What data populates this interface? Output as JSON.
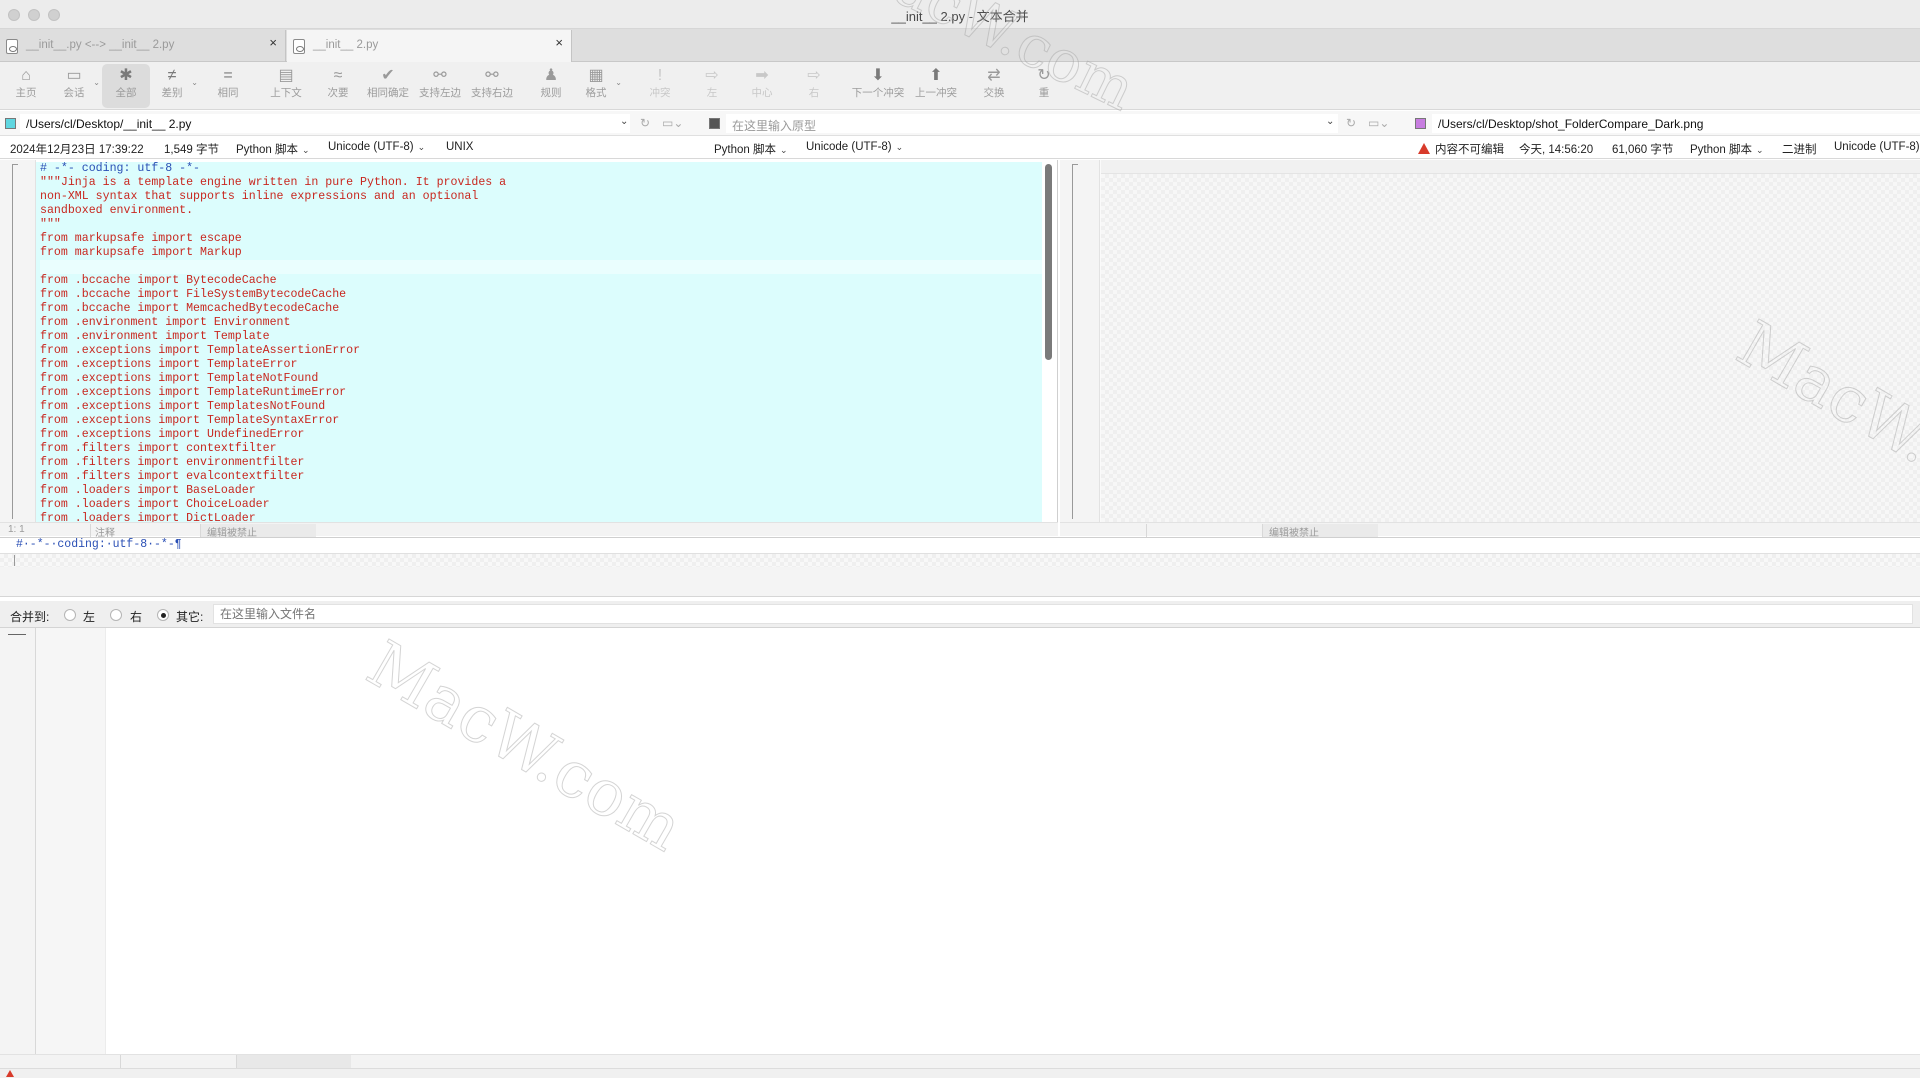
{
  "window": {
    "title": "__init__ 2.py - 文本合并"
  },
  "tabs": [
    {
      "label": "__init__.py <--> __init__ 2.py",
      "active": false
    },
    {
      "label": "__init__ 2.py",
      "active": true
    }
  ],
  "toolbar": {
    "items": [
      {
        "label": "主页",
        "icon": "home-icon",
        "glyph": "⌂"
      },
      {
        "label": "会话",
        "icon": "session-icon",
        "glyph": "▭"
      },
      {
        "label": "全部",
        "icon": "asterisk-icon",
        "glyph": "✱"
      },
      {
        "label": "差别",
        "icon": "not-equal-icon",
        "glyph": "≠"
      },
      {
        "label": "相同",
        "icon": "equal-icon",
        "glyph": "="
      },
      {
        "label": "上下文",
        "icon": "context-icon",
        "glyph": "▤"
      },
      {
        "label": "次要",
        "icon": "approx-icon",
        "glyph": "≈"
      },
      {
        "label": "相同确定",
        "icon": "check-icon",
        "glyph": "✔"
      },
      {
        "label": "支持左边",
        "icon": "link-left-icon",
        "glyph": "⚯"
      },
      {
        "label": "支持右边",
        "icon": "link-right-icon",
        "glyph": "⚯"
      },
      {
        "label": "规则",
        "icon": "rules-icon",
        "glyph": "♟"
      },
      {
        "label": "格式",
        "icon": "format-icon",
        "glyph": "▦"
      },
      {
        "label": "冲突",
        "icon": "conflict-icon",
        "glyph": "!"
      },
      {
        "label": "左",
        "icon": "arrow-left-icon",
        "glyph": "⇨"
      },
      {
        "label": "中心",
        "icon": "arrow-center-icon",
        "glyph": "➡"
      },
      {
        "label": "右",
        "icon": "arrow-right-icon",
        "glyph": "⇨"
      },
      {
        "label": "下一个冲突",
        "icon": "next-conflict-icon",
        "glyph": "⬇"
      },
      {
        "label": "上一冲突",
        "icon": "prev-conflict-icon",
        "glyph": "⬆"
      },
      {
        "label": "交换",
        "icon": "swap-icon",
        "glyph": "⇄"
      },
      {
        "label": "重",
        "icon": "reload-icon",
        "glyph": "↻"
      }
    ]
  },
  "paths": {
    "left": "/Users/cl/Desktop/__init__ 2.py",
    "center_placeholder": "在这里输入原型",
    "right": "/Users/cl/Desktop/shot_FolderCompare_Dark.png"
  },
  "info": {
    "left_date": "2024年12月23日 17:39:22",
    "left_size": "1,549 字节",
    "left_format": "Python 脚本",
    "left_encoding": "Unicode (UTF-8)",
    "left_lineend": "UNIX",
    "center_format": "Python 脚本",
    "center_encoding": "Unicode (UTF-8)",
    "right_warning": "内容不可编辑",
    "right_date": "今天, 14:56:20",
    "right_size": "61,060 字节",
    "right_format": "Python 脚本",
    "right_mode": "二进制",
    "right_encoding": "Unicode (UTF-8)"
  },
  "code_lines": [
    "# -*- coding: utf-8 -*-",
    "\"\"\"Jinja is a template engine written in pure Python. It provides a",
    "non-XML syntax that supports inline expressions and an optional",
    "sandboxed environment.",
    "\"\"\"",
    "from markupsafe import escape",
    "from markupsafe import Markup",
    "",
    "from .bccache import BytecodeCache",
    "from .bccache import FileSystemBytecodeCache",
    "from .bccache import MemcachedBytecodeCache",
    "from .environment import Environment",
    "from .environment import Template",
    "from .exceptions import TemplateAssertionError",
    "from .exceptions import TemplateError",
    "from .exceptions import TemplateNotFound",
    "from .exceptions import TemplateRuntimeError",
    "from .exceptions import TemplatesNotFound",
    "from .exceptions import TemplateSyntaxError",
    "from .exceptions import UndefinedError",
    "from .filters import contextfilter",
    "from .filters import environmentfilter",
    "from .filters import evalcontextfilter",
    "from .loaders import BaseLoader",
    "from .loaders import ChoiceLoader",
    "from .loaders import DictLoader"
  ],
  "left_status": {
    "position": "1: 1",
    "kind": "注释",
    "edit": "编辑被禁止"
  },
  "right_status": {
    "edit": "编辑被禁止"
  },
  "diff_line": "#·-*-·coding:·utf-8·-*-¶",
  "merge": {
    "label": "合并到:",
    "left": "左",
    "right": "右",
    "other": "其它:",
    "selected": "other",
    "filename_placeholder": "在这里输入文件名"
  },
  "watermark": "MacW.com"
}
